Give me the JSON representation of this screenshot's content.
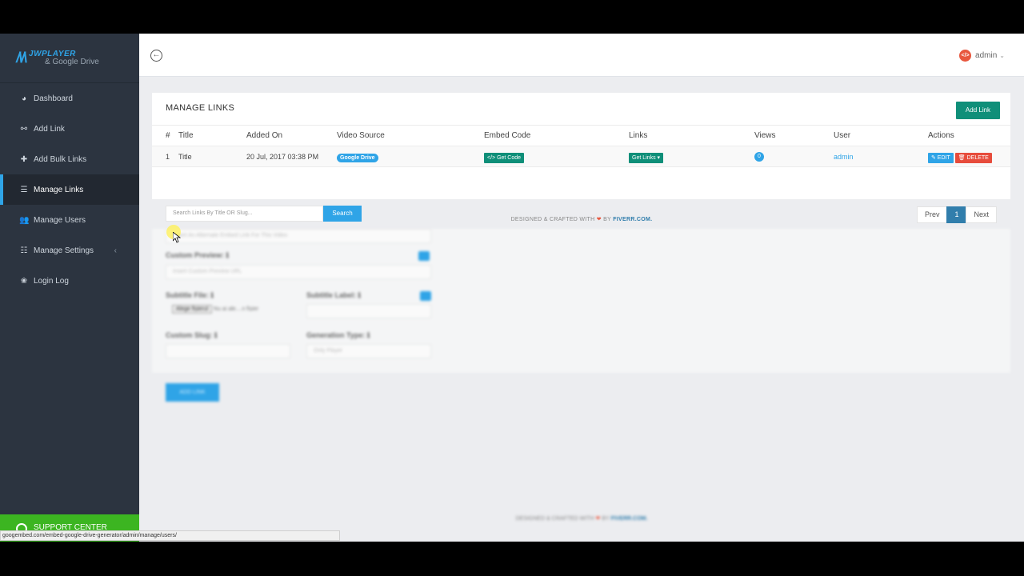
{
  "brand": {
    "logo_title": "JWPLAYER",
    "logo_sub": "& Google Drive"
  },
  "sidebar": {
    "items": [
      {
        "label": "Dashboard",
        "icon": "dashboard-icon"
      },
      {
        "label": "Add Link",
        "icon": "link-icon"
      },
      {
        "label": "Add Bulk Links",
        "icon": "plus-icon"
      },
      {
        "label": "Manage Links",
        "icon": "list-icon",
        "active": true
      },
      {
        "label": "Manage Users",
        "icon": "users-icon"
      },
      {
        "label": "Manage Settings",
        "icon": "sliders-icon",
        "caret": "‹"
      },
      {
        "label": "Login Log",
        "icon": "paw-icon"
      }
    ],
    "support_label": "SUPPORT CENTER"
  },
  "header": {
    "user": "admin"
  },
  "panel": {
    "title": "MANAGE LINKS",
    "add_link_label": "Add Link",
    "columns": [
      "#",
      "Title",
      "Added On",
      "Video Source",
      "Embed Code",
      "Links",
      "Views",
      "User",
      "Actions"
    ],
    "rows": [
      {
        "num": "1",
        "title": "Title",
        "added_on": "20 Jul, 2017 03:38 PM",
        "source": "Google Drive",
        "embed": "</> Get Code",
        "links": "Get Links ▾",
        "views": "0",
        "user": "admin",
        "edit": "✎ EDIT",
        "delete": "🗑 DELETE"
      }
    ],
    "search_placeholder": "Search Links By Title OR Slug...",
    "search_label": "Search",
    "pager": {
      "prev": "Prev",
      "current": "1",
      "next": "Next"
    }
  },
  "footer": {
    "prefix": "DESIGNED & CRAFTED WITH",
    "heart": "❤",
    "by": "BY",
    "brand": "FIVERR.COM."
  },
  "blurred_form": {
    "alt_embed_placeholder": "Insert An Alternate Embed Link For This Video",
    "custom_preview_label": "Custom Preview: ℹ",
    "custom_preview_placeholder": "Insert Custom Preview URL",
    "subtitle_file_label": "Subtitle File: ℹ",
    "subtitle_label_label": "Subtitle Label: ℹ",
    "file_button": "Alege fișierul",
    "file_status": "Nu ai ale....n fișier",
    "custom_slug_label": "Custom Slug: ℹ",
    "generation_type_label": "Generation Type: ℹ",
    "generation_type_value": "Only Player",
    "add_link_button": "ADD LINK"
  },
  "status_url": "googembed.com/embed-google-drive-generator/admin/manage/users/",
  "colors": {
    "sidebar": "#2c3440",
    "primary": "#2fa4e7",
    "success": "#0f8f79",
    "danger": "#e74c3c",
    "support": "#3cb521"
  }
}
